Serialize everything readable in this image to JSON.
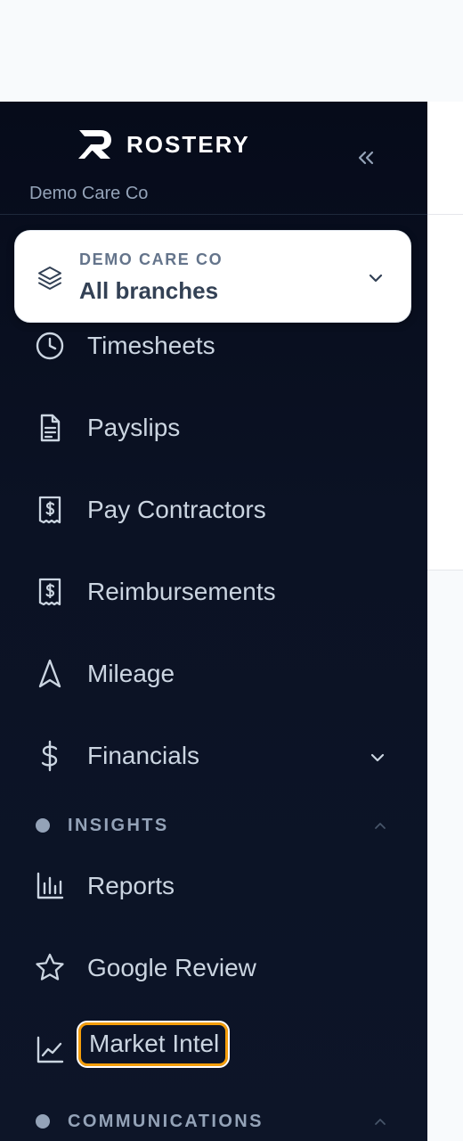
{
  "brand": {
    "name": "ROSTERY",
    "org_name": "Demo Care Co"
  },
  "branch_selector": {
    "caption": "DEMO CARE CO",
    "value": "All branches"
  },
  "nav_items": [
    {
      "label": "Timesheets",
      "icon": "clock-icon"
    },
    {
      "label": "Payslips",
      "icon": "document-icon"
    },
    {
      "label": "Pay Contractors",
      "icon": "receipt-dollar-icon"
    },
    {
      "label": "Reimbursements",
      "icon": "receipt-dollar-icon"
    },
    {
      "label": "Mileage",
      "icon": "navigation-arrow-icon"
    },
    {
      "label": "Financials",
      "icon": "dollar-icon",
      "expandable": true
    }
  ],
  "sections": [
    {
      "label": "INSIGHTS",
      "expanded": true,
      "items": [
        {
          "label": "Reports",
          "icon": "bar-chart-icon"
        },
        {
          "label": "Google Review",
          "icon": "star-icon"
        },
        {
          "label": "Market Intel",
          "icon": "line-chart-icon",
          "focused": true
        }
      ]
    },
    {
      "label": "COMMUNICATIONS",
      "expanded": true,
      "items": []
    }
  ],
  "colors": {
    "sidebar_bg": "#0b1224",
    "nav_text": "#cbd5e1",
    "muted_text": "#94a3b8",
    "focus_ring": "#f59e0b"
  }
}
